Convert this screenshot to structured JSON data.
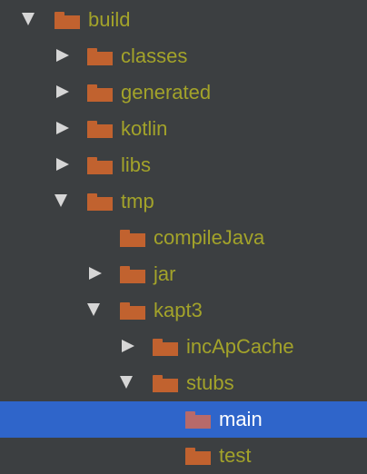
{
  "colors": {
    "background": "#3c3f41",
    "folder": "#c1622f",
    "folder_selected": "#b76a6a",
    "label": "#a3a32a",
    "label_selected": "#ffffff",
    "selection": "#2f65ca",
    "arrow": "#d6d6d6"
  },
  "tree": {
    "rows": [
      {
        "label": "build",
        "depth": 0,
        "arrow": "expanded",
        "selected": false,
        "icon": "folder-icon"
      },
      {
        "label": "classes",
        "depth": 1,
        "arrow": "collapsed",
        "selected": false,
        "icon": "folder-icon"
      },
      {
        "label": "generated",
        "depth": 1,
        "arrow": "collapsed",
        "selected": false,
        "icon": "folder-icon"
      },
      {
        "label": "kotlin",
        "depth": 1,
        "arrow": "collapsed",
        "selected": false,
        "icon": "folder-icon"
      },
      {
        "label": "libs",
        "depth": 1,
        "arrow": "collapsed",
        "selected": false,
        "icon": "folder-icon"
      },
      {
        "label": "tmp",
        "depth": 1,
        "arrow": "expanded",
        "selected": false,
        "icon": "folder-icon"
      },
      {
        "label": "compileJava",
        "depth": 2,
        "arrow": "none",
        "selected": false,
        "icon": "folder-icon"
      },
      {
        "label": "jar",
        "depth": 2,
        "arrow": "collapsed",
        "selected": false,
        "icon": "folder-icon"
      },
      {
        "label": "kapt3",
        "depth": 2,
        "arrow": "expanded",
        "selected": false,
        "icon": "folder-icon"
      },
      {
        "label": "incApCache",
        "depth": 3,
        "arrow": "collapsed",
        "selected": false,
        "icon": "folder-icon"
      },
      {
        "label": "stubs",
        "depth": 3,
        "arrow": "expanded",
        "selected": false,
        "icon": "folder-icon"
      },
      {
        "label": "main",
        "depth": 4,
        "arrow": "none",
        "selected": true,
        "icon": "folder-icon"
      },
      {
        "label": "test",
        "depth": 4,
        "arrow": "none",
        "selected": false,
        "icon": "folder-icon"
      }
    ]
  }
}
